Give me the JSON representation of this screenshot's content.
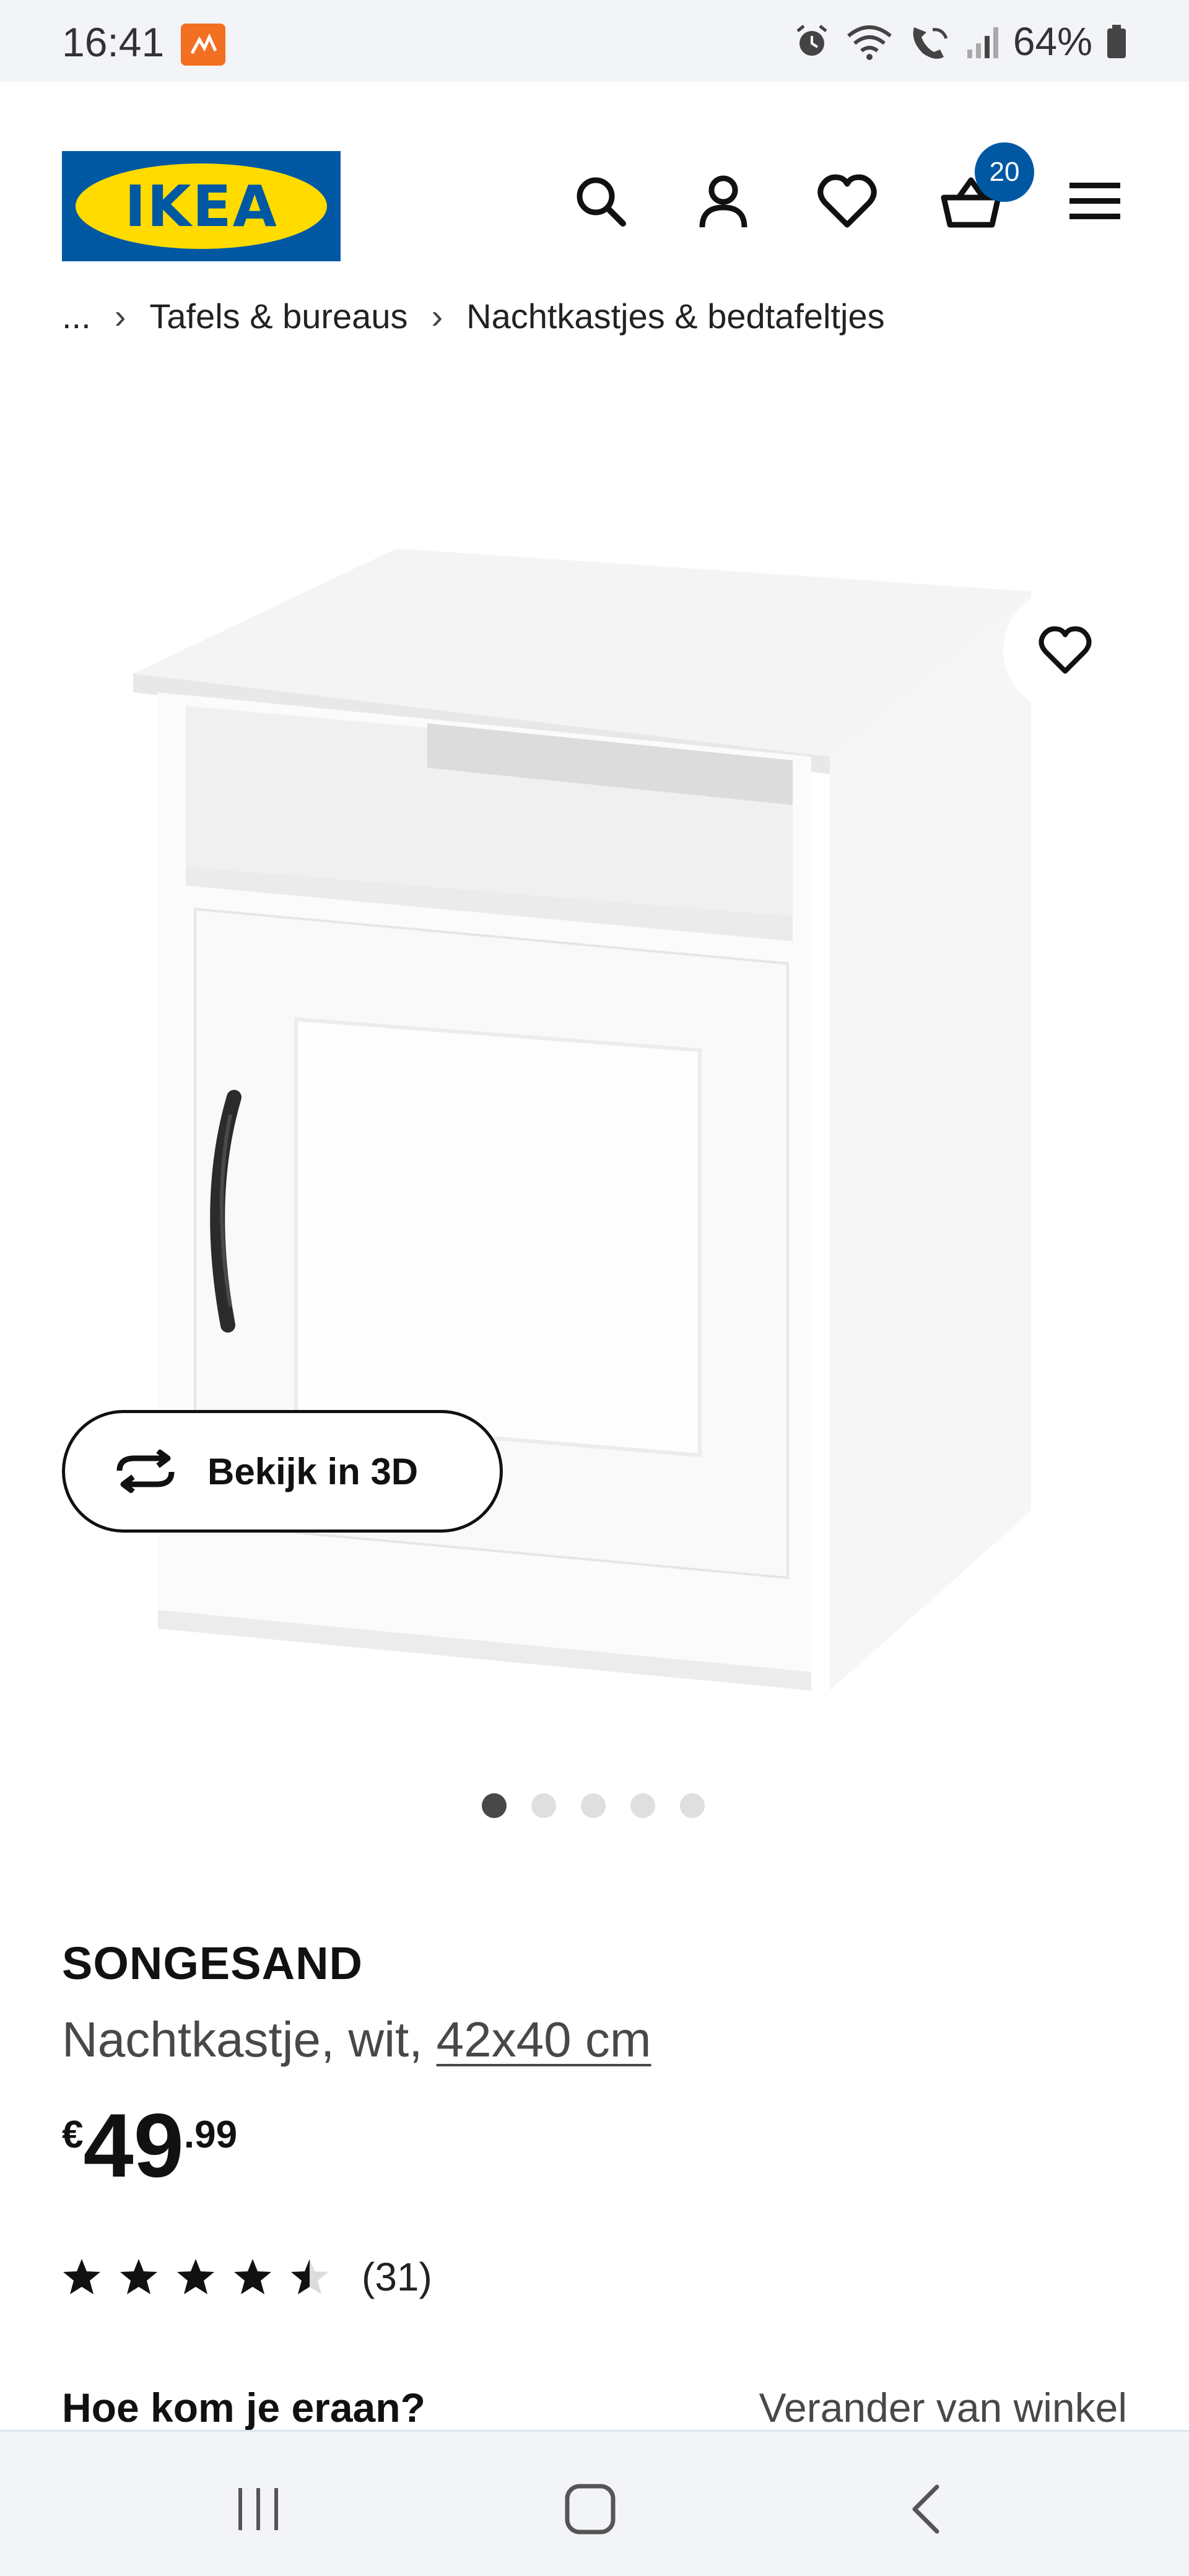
{
  "status_bar": {
    "time": "16:41",
    "battery": "64%",
    "icons": [
      "alarm-icon",
      "wifi-icon",
      "wifi-calling-icon",
      "signal-icon",
      "battery-icon"
    ]
  },
  "header": {
    "logo_text": "IKEA",
    "cart_count": "20",
    "icons": [
      "search-icon",
      "account-icon",
      "heart-icon",
      "basket-icon",
      "menu-icon"
    ],
    "brand_colors": {
      "blue": "#0058a3",
      "yellow": "#ffdb00"
    }
  },
  "breadcrumb": {
    "items": [
      "...",
      "Tafels & bureaus",
      "Nachtkastjes & bedtafeltjes"
    ]
  },
  "gallery": {
    "view_3d_label": "Bekijk in 3D",
    "image_count": 5,
    "active_index": 0
  },
  "product": {
    "name": "SONGESAND",
    "description": "Nachtkastje, wit,",
    "size": "42x40 cm",
    "price": {
      "currency": "€",
      "integer": "49",
      "decimal": ".99"
    },
    "rating": {
      "value": 4.5,
      "max": 5,
      "count": "(31)"
    }
  },
  "store": {
    "question": "Hoe kom je eraan?",
    "change_link": "Verander van winkel"
  },
  "nav_bar": {
    "icons": [
      "recent-apps-icon",
      "home-icon",
      "back-icon"
    ]
  }
}
